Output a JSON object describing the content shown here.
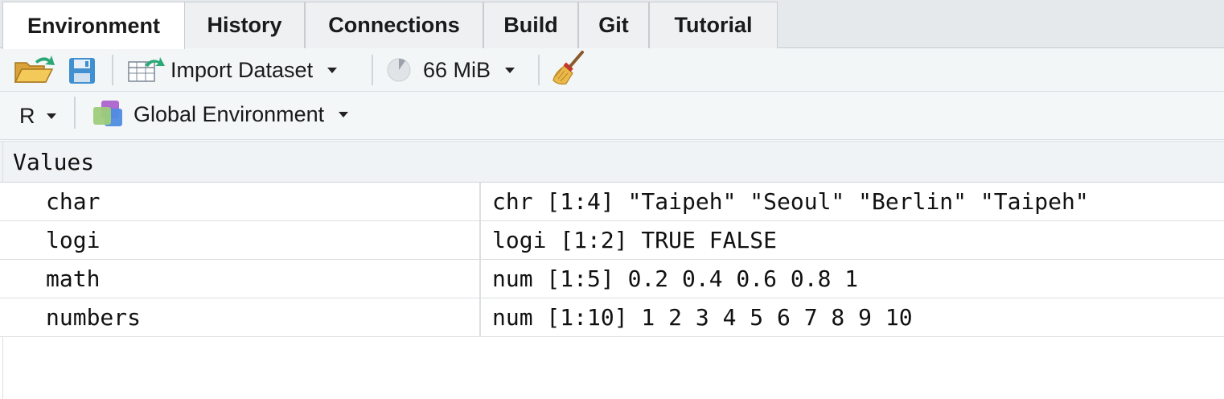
{
  "tabs": [
    {
      "label": "Environment",
      "active": true
    },
    {
      "label": "History",
      "active": false
    },
    {
      "label": "Connections",
      "active": false
    },
    {
      "label": "Build",
      "active": false
    },
    {
      "label": "Git",
      "active": false
    },
    {
      "label": "Tutorial",
      "active": false
    }
  ],
  "toolbar": {
    "open_icon": "open-folder-icon",
    "save_icon": "save-disk-icon",
    "import_label": "Import Dataset",
    "import_icon": "import-table-icon",
    "memory_label": "66 MiB",
    "memory_icon": "memory-pie-icon",
    "broom_icon": "broom-icon"
  },
  "env_bar": {
    "language": "R",
    "environment": "Global Environment",
    "env_icon": "environment-stack-icon"
  },
  "section": {
    "title": "Values"
  },
  "rows": [
    {
      "name": "char",
      "value": "chr [1:4] \"Taipeh\" \"Seoul\" \"Berlin\" \"Taipeh\""
    },
    {
      "name": "logi",
      "value": "logi [1:2] TRUE FALSE"
    },
    {
      "name": "math",
      "value": "num [1:5] 0.2 0.4 0.6 0.8 1"
    },
    {
      "name": "numbers",
      "value": "num [1:10] 1 2 3 4 5 6 7 8 9 10"
    }
  ],
  "colors": {
    "accent_green": "#2aa876",
    "folder_yellow": "#e8b84a",
    "disk_blue": "#3f8fd1"
  }
}
